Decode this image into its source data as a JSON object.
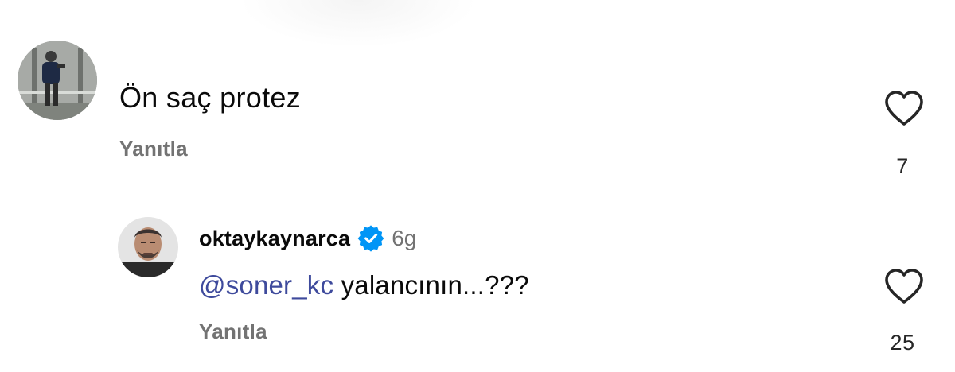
{
  "comments": [
    {
      "text": "Ön saç protez",
      "reply_label": "Yanıtla",
      "like_count": "7",
      "like_icon": "heart-outline-icon"
    },
    {
      "username": "oktaykaynarca",
      "verified": true,
      "time": "6g",
      "mention": "@soner_kc",
      "text": " yalancının...???",
      "reply_label": "Yanıtla",
      "like_count": "25",
      "like_icon": "heart-outline-icon"
    }
  ],
  "colors": {
    "mention": "#3e4a9c",
    "verified": "#0095f6",
    "secondary_text": "#737373"
  }
}
